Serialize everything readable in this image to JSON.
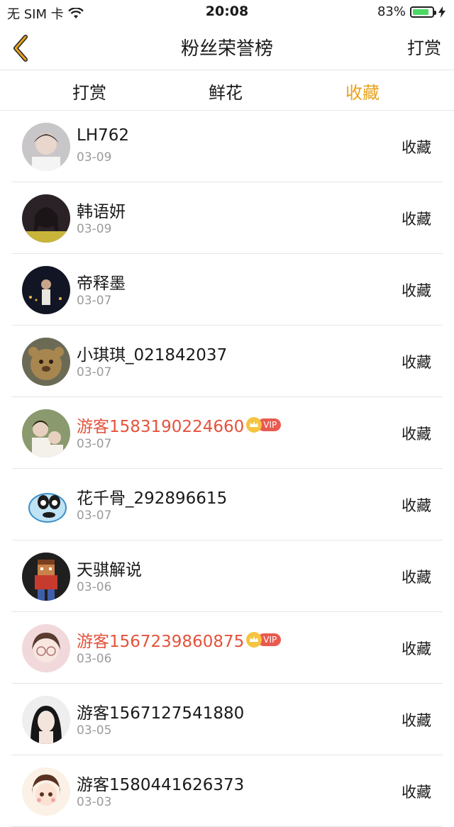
{
  "status_bar": {
    "carrier": "无 SIM 卡",
    "time": "20:08",
    "battery_pct": "83%",
    "battery_level": 0.83
  },
  "nav": {
    "title": "粉丝荣誉榜",
    "action_label": "打赏",
    "back_icon": "chevron-left-icon"
  },
  "tabs": [
    {
      "label": "打赏",
      "active": false
    },
    {
      "label": "鲜花",
      "active": false
    },
    {
      "label": "收藏",
      "active": true
    }
  ],
  "colors": {
    "accent": "#e8a21c",
    "vip_name": "#e4533c",
    "date_gray": "#9b9b9b"
  },
  "fans": [
    {
      "name": "LH762",
      "date": "03-09",
      "action": "收藏",
      "vip": false
    },
    {
      "name": "韩语妍",
      "date": "03-09",
      "action": "收藏",
      "vip": false
    },
    {
      "name": "帝释墨",
      "date": "03-07",
      "action": "收藏",
      "vip": false
    },
    {
      "name": "小琪琪_021842037",
      "date": "03-07",
      "action": "收藏",
      "vip": false
    },
    {
      "name": "游客1583190224660",
      "date": "03-07",
      "action": "收藏",
      "vip": true,
      "vip_label": "VIP"
    },
    {
      "name": "花千骨_292896615",
      "date": "03-07",
      "action": "收藏",
      "vip": false
    },
    {
      "name": "天骐解说",
      "date": "03-06",
      "action": "收藏",
      "vip": false
    },
    {
      "name": "游客1567239860875",
      "date": "03-06",
      "action": "收藏",
      "vip": true,
      "vip_label": "VIP"
    },
    {
      "name": "游客1567127541880",
      "date": "03-05",
      "action": "收藏",
      "vip": false
    },
    {
      "name": "游客1580441626373",
      "date": "03-03",
      "action": "收藏",
      "vip": false
    }
  ]
}
